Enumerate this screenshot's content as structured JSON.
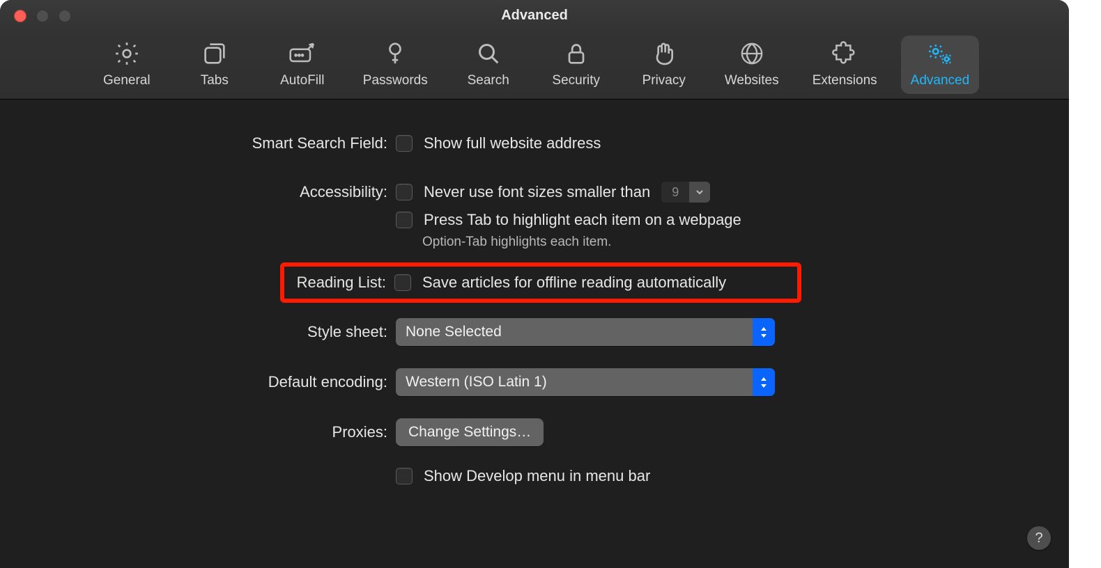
{
  "window": {
    "title": "Advanced"
  },
  "tabs": [
    {
      "label": "General"
    },
    {
      "label": "Tabs"
    },
    {
      "label": "AutoFill"
    },
    {
      "label": "Passwords"
    },
    {
      "label": "Search"
    },
    {
      "label": "Security"
    },
    {
      "label": "Privacy"
    },
    {
      "label": "Websites"
    },
    {
      "label": "Extensions"
    },
    {
      "label": "Advanced"
    }
  ],
  "form": {
    "smart_search": {
      "label": "Smart Search Field:",
      "option": "Show full website address"
    },
    "accessibility": {
      "label": "Accessibility:",
      "font_option": "Never use font sizes smaller than",
      "font_value": "9",
      "tab_option": "Press Tab to highlight each item on a webpage",
      "tab_hint": "Option-Tab highlights each item."
    },
    "reading_list": {
      "label": "Reading List:",
      "option": "Save articles for offline reading automatically"
    },
    "style_sheet": {
      "label": "Style sheet:",
      "value": "None Selected"
    },
    "encoding": {
      "label": "Default encoding:",
      "value": "Western (ISO Latin 1)"
    },
    "proxies": {
      "label": "Proxies:",
      "button": "Change Settings…"
    },
    "develop": {
      "option": "Show Develop menu in menu bar"
    }
  },
  "help": "?"
}
